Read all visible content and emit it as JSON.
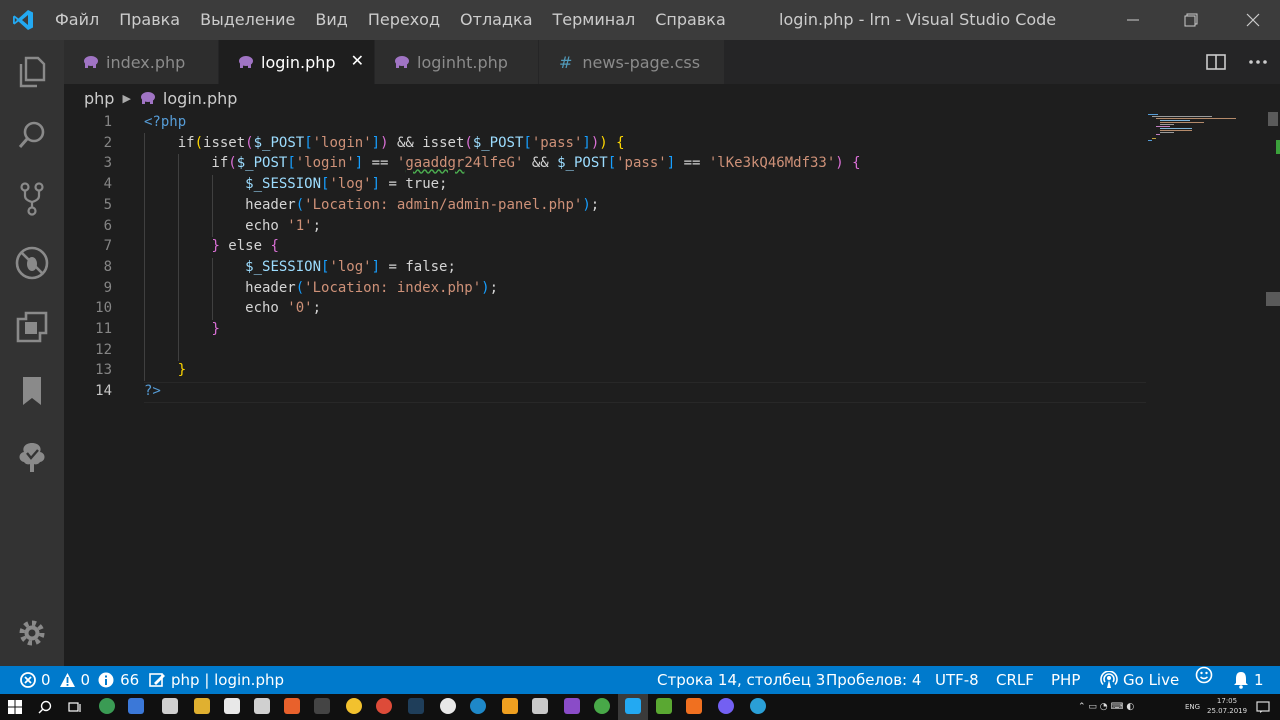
{
  "titlebar": {
    "menu": [
      "Файл",
      "Правка",
      "Выделение",
      "Вид",
      "Переход",
      "Отладка",
      "Терминал",
      "Справка"
    ],
    "window_title": "login.php - lrn - Visual Studio Code"
  },
  "tabs": [
    {
      "label": "index.php",
      "icon": "php-elephant-icon",
      "active": false
    },
    {
      "label": "login.php",
      "icon": "php-elephant-icon",
      "active": true
    },
    {
      "label": "loginht.php",
      "icon": "php-elephant-icon",
      "active": false
    },
    {
      "label": "news-page.css",
      "icon": "css-hash-icon",
      "active": false
    }
  ],
  "breadcrumb": {
    "folder": "php",
    "file": "login.php"
  },
  "editor": {
    "line_numbers": [
      "1",
      "2",
      "3",
      "4",
      "5",
      "6",
      "7",
      "8",
      "9",
      "10",
      "11",
      "12",
      "13",
      "14"
    ],
    "current_line": 14,
    "lines": [
      "<?php",
      "    if(isset($_POST['login']) && isset($_POST['pass'])) {",
      "        if($_POST['login'] == 'gaaddgr24lfeG' && $_POST['pass'] == 'lKe3kQ46Mdf33') {",
      "            $_SESSION['log'] = true;",
      "            header('Location: admin/admin-panel.php');",
      "            echo '1';",
      "        } else {",
      "            $_SESSION['log'] = false;",
      "            header('Location: index.php');",
      "            echo '0';",
      "        }",
      "",
      "    }",
      "?>"
    ]
  },
  "statusbar": {
    "errors": "0",
    "warnings": "0",
    "infos": "66",
    "crumb": "php | login.php",
    "position": "Строка 14, столбец 3",
    "spaces": "Пробелов: 4",
    "encoding": "UTF-8",
    "eol": "CRLF",
    "language": "PHP",
    "golive": "Go Live",
    "notifications": "1"
  },
  "taskbar": {
    "lang": "ENG",
    "time": "17:05",
    "date": "25.07.2019"
  },
  "colors": {
    "accent": "#007acc",
    "titlebar": "#3c3c3c",
    "editor_bg": "#1e1e1e"
  }
}
